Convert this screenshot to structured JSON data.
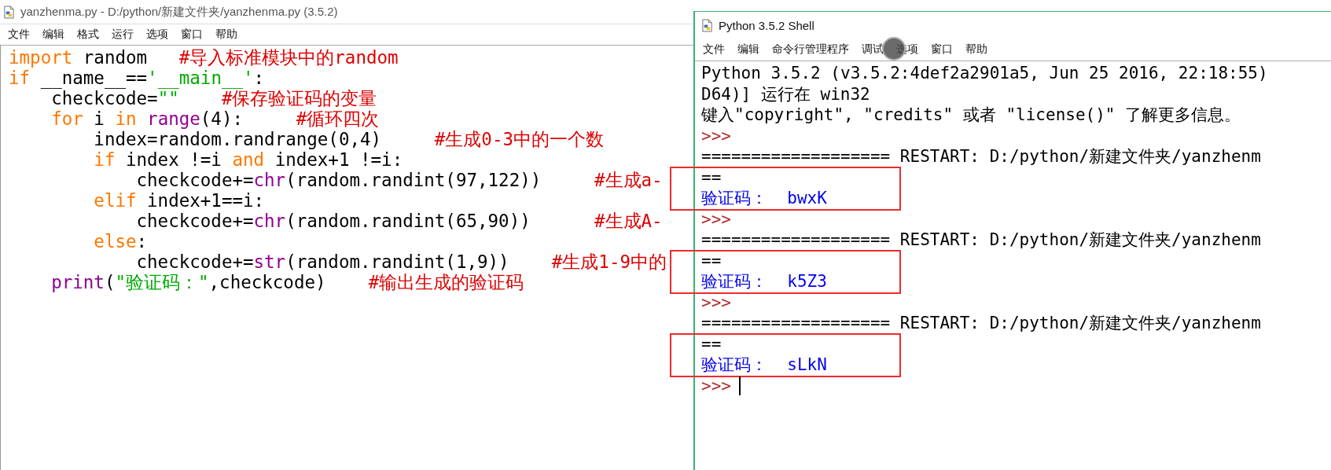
{
  "editor": {
    "title": "yanzhenma.py - D:/python/新建文件夹/yanzhenma.py (3.5.2)",
    "menu": [
      "文件",
      "编辑",
      "格式",
      "运行",
      "选项",
      "窗口",
      "帮助"
    ],
    "lines": [
      {
        "tokens": [
          {
            "kind": "keyword",
            "text": "import"
          },
          {
            "kind": "plain",
            "text": " random   "
          },
          {
            "kind": "comment",
            "text": "#导入标准模块中的random"
          }
        ]
      },
      {
        "tokens": [
          {
            "kind": "keyword",
            "text": "if"
          },
          {
            "kind": "plain",
            "text": " __name__=="
          },
          {
            "kind": "string",
            "text": "'__main__'"
          },
          {
            "kind": "plain",
            "text": ":"
          }
        ],
        "children": [
          {
            "tokens": [
              {
                "kind": "plain",
                "text": "checkcode="
              },
              {
                "kind": "string",
                "text": "\"\"    "
              },
              {
                "kind": "comment",
                "text": "#保存验证码的变量"
              }
            ]
          },
          {
            "tokens": [
              {
                "kind": "keyword",
                "text": "for"
              },
              {
                "kind": "plain",
                "text": " i "
              },
              {
                "kind": "keyword",
                "text": "in"
              },
              {
                "kind": "builtin",
                "text": " range"
              },
              {
                "kind": "plain",
                "text": "(4):     "
              },
              {
                "kind": "comment",
                "text": "#循环四次"
              }
            ],
            "children": [
              {
                "tokens": [
                  {
                    "kind": "plain",
                    "text": "index=random.randrange(0,4)     "
                  },
                  {
                    "kind": "comment",
                    "text": "#生成0-3中的一个数"
                  }
                ]
              },
              {
                "tokens": [
                  {
                    "kind": "keyword",
                    "text": "if"
                  },
                  {
                    "kind": "plain",
                    "text": " index !=i "
                  },
                  {
                    "kind": "keyword",
                    "text": "and"
                  },
                  {
                    "kind": "plain",
                    "text": " index+1 !=i:"
                  }
                ],
                "children": [
                  {
                    "tokens": [
                      {
                        "kind": "plain",
                        "text": "checkcode+="
                      },
                      {
                        "kind": "builtin",
                        "text": "chr"
                      },
                      {
                        "kind": "plain",
                        "text": "(random.randint(97,122))     "
                      },
                      {
                        "kind": "comment",
                        "text": "#生成a-"
                      }
                    ]
                  }
                ]
              },
              {
                "tokens": [
                  {
                    "kind": "keyword",
                    "text": "elif"
                  },
                  {
                    "kind": "plain",
                    "text": " index+1==i:"
                  }
                ],
                "children": [
                  {
                    "tokens": [
                      {
                        "kind": "plain",
                        "text": "checkcode+="
                      },
                      {
                        "kind": "builtin",
                        "text": "chr"
                      },
                      {
                        "kind": "plain",
                        "text": "(random.randint(65,90))      "
                      },
                      {
                        "kind": "comment",
                        "text": "#生成A-"
                      }
                    ]
                  }
                ]
              },
              {
                "tokens": [
                  {
                    "kind": "keyword",
                    "text": "else"
                  },
                  {
                    "kind": "plain",
                    "text": ":"
                  }
                ],
                "children": [
                  {
                    "tokens": [
                      {
                        "kind": "plain",
                        "text": "checkcode+="
                      },
                      {
                        "kind": "builtin",
                        "text": "str"
                      },
                      {
                        "kind": "plain",
                        "text": "(random.randint(1,9))    "
                      },
                      {
                        "kind": "comment",
                        "text": "#生成1-9中的"
                      }
                    ]
                  }
                ]
              }
            ]
          },
          {
            "tokens": [
              {
                "kind": "builtin",
                "text": "print"
              },
              {
                "kind": "plain",
                "text": "("
              },
              {
                "kind": "string",
                "text": "\"验证码：\""
              },
              {
                "kind": "plain",
                "text": ",checkcode)    "
              },
              {
                "kind": "comment",
                "text": "#输出生成的验证码"
              }
            ]
          }
        ]
      }
    ]
  },
  "shell": {
    "title": "Python 3.5.2 Shell",
    "menu": [
      "文件",
      "编辑",
      "命令行管理程序",
      "调试",
      "选项",
      "窗口",
      "帮助"
    ],
    "lines": [
      {
        "kind": "text",
        "text": "Python 3.5.2 (v3.5.2:4def2a2901a5, Jun 25 2016, 22:18:55)"
      },
      {
        "kind": "text",
        "text": "D64)] 运行在 win32"
      },
      {
        "kind": "text",
        "text": "键入\"copyright\", \"credits\" 或者 \"license()\" 了解更多信息。"
      },
      {
        "kind": "prompt",
        "text": ">>>",
        "cursor": false
      },
      {
        "kind": "text",
        "text": "=================== RESTART: D:/python/新建文件夹/yanzhenm"
      },
      {
        "kind": "text",
        "text": "=="
      },
      {
        "kind": "output",
        "text": "验证码：  bwxK",
        "boxed": true
      },
      {
        "kind": "prompt",
        "text": ">>>",
        "cursor": false
      },
      {
        "kind": "text",
        "text": "=================== RESTART: D:/python/新建文件夹/yanzhenm"
      },
      {
        "kind": "text",
        "text": "=="
      },
      {
        "kind": "output",
        "text": "验证码：  k5Z3",
        "boxed": true
      },
      {
        "kind": "prompt",
        "text": ">>>",
        "cursor": false
      },
      {
        "kind": "text",
        "text": "=================== RESTART: D:/python/新建文件夹/yanzhenm"
      },
      {
        "kind": "text",
        "text": "=="
      },
      {
        "kind": "output",
        "text": "验证码：  sLkN",
        "boxed": true
      },
      {
        "kind": "prompt",
        "text": ">>>",
        "cursor": true
      }
    ]
  }
}
